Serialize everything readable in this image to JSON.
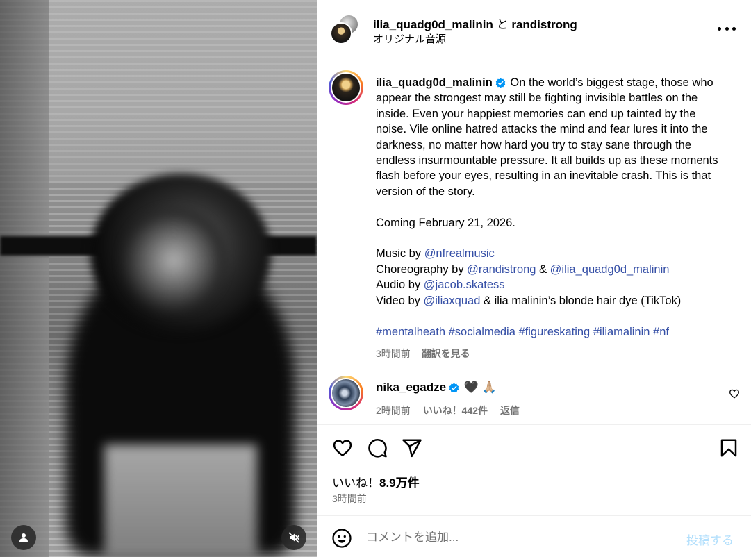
{
  "header": {
    "user1": "ilia_quadg0d_malinin",
    "conjunction": "と",
    "user2": "randistrong",
    "audio": "オリジナル音源"
  },
  "caption": {
    "username": "ilia_quadg0d_malinin",
    "body": "On the world’s biggest stage, those who appear the strongest may still be fighting invisible battles on the inside. Even your happiest memories can end up tainted by the noise. Vile online hatred attacks the mind and fear lures it into the darkness, no matter how hard you try to stay sane through the endless insurmountable pressure. It all builds up as these moments flash before your eyes, resulting in an inevitable crash. This is that version of the story.",
    "coming": "Coming February 21, 2026.",
    "music_label": "Music by ",
    "music_mention": "@nfrealmusic",
    "choreo_label": "Choreography by ",
    "choreo_mention1": "@randistrong",
    "choreo_amp": " & ",
    "choreo_mention2": "@ilia_quadg0d_malinin",
    "audio_label": "Audio by ",
    "audio_mention": "@jacob.skatess",
    "video_label": "Video by ",
    "video_mention": "@iliaxquad",
    "video_rest": " & ilia malinin’s blonde hair dye (TikTok)",
    "hashtags": [
      "#mentalheath",
      "#socialmedia",
      "#figureskating",
      "#iliamalinin",
      "#nf"
    ],
    "time": "3時間前",
    "see_translation": "翻訳を見る"
  },
  "comment": {
    "username": "nika_egadze",
    "text": "🖤 🙏🏼",
    "time": "2時間前",
    "likes": "いいね！442件",
    "reply": "返信"
  },
  "stats": {
    "likes_prefix": "いいね！",
    "likes_count": "8.9万件",
    "time": "3時間前"
  },
  "composer": {
    "placeholder": "コメントを追加...",
    "post_label": "投稿する"
  },
  "colors": {
    "link": "#354fa6",
    "verified": "#0095f6",
    "muted": "#737373",
    "post_disabled": "#b2dffc"
  }
}
